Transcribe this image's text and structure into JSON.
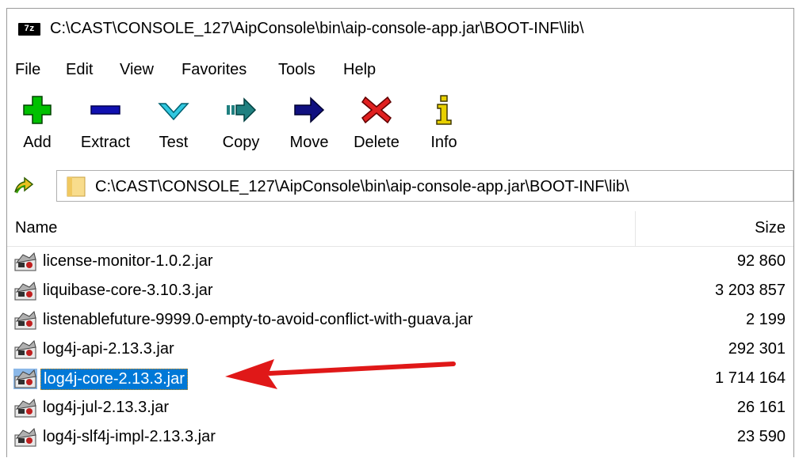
{
  "window": {
    "app_logo_text": "7z",
    "title": "C:\\CAST\\CONSOLE_127\\AipConsole\\bin\\aip-console-app.jar\\BOOT-INF\\lib\\"
  },
  "menu": [
    "File",
    "Edit",
    "View",
    "Favorites",
    "Tools",
    "Help"
  ],
  "toolbar": [
    {
      "label": "Add",
      "icon": "add-icon",
      "color": "#00c000"
    },
    {
      "label": "Extract",
      "icon": "extract-icon",
      "color": "#1010b0"
    },
    {
      "label": "Test",
      "icon": "test-icon",
      "color": "#30c8e0"
    },
    {
      "label": "Copy",
      "icon": "copy-icon",
      "color": "#208080"
    },
    {
      "label": "Move",
      "icon": "move-icon",
      "color": "#101080"
    },
    {
      "label": "Delete",
      "icon": "delete-icon",
      "color": "#e02020"
    },
    {
      "label": "Info",
      "icon": "info-icon",
      "color": "#e8d000"
    }
  ],
  "address": {
    "path": "C:\\CAST\\CONSOLE_127\\AipConsole\\bin\\aip-console-app.jar\\BOOT-INF\\lib\\"
  },
  "columns": {
    "name": "Name",
    "size": "Size"
  },
  "files": [
    {
      "name": "license-monitor-1.0.2.jar",
      "size": "92 860",
      "selected": false
    },
    {
      "name": "liquibase-core-3.10.3.jar",
      "size": "3 203 857",
      "selected": false
    },
    {
      "name": "listenablefuture-9999.0-empty-to-avoid-conflict-with-guava.jar",
      "size": "2 199",
      "selected": false
    },
    {
      "name": "log4j-api-2.13.3.jar",
      "size": "292 301",
      "selected": false
    },
    {
      "name": "log4j-core-2.13.3.jar",
      "size": "1 714 164",
      "selected": true
    },
    {
      "name": "log4j-jul-2.13.3.jar",
      "size": "26 161",
      "selected": false
    },
    {
      "name": "log4j-slf4j-impl-2.13.3.jar",
      "size": "23 590",
      "selected": false
    }
  ],
  "colors": {
    "selection": "#0078d7",
    "annotation_arrow": "#e01818"
  }
}
